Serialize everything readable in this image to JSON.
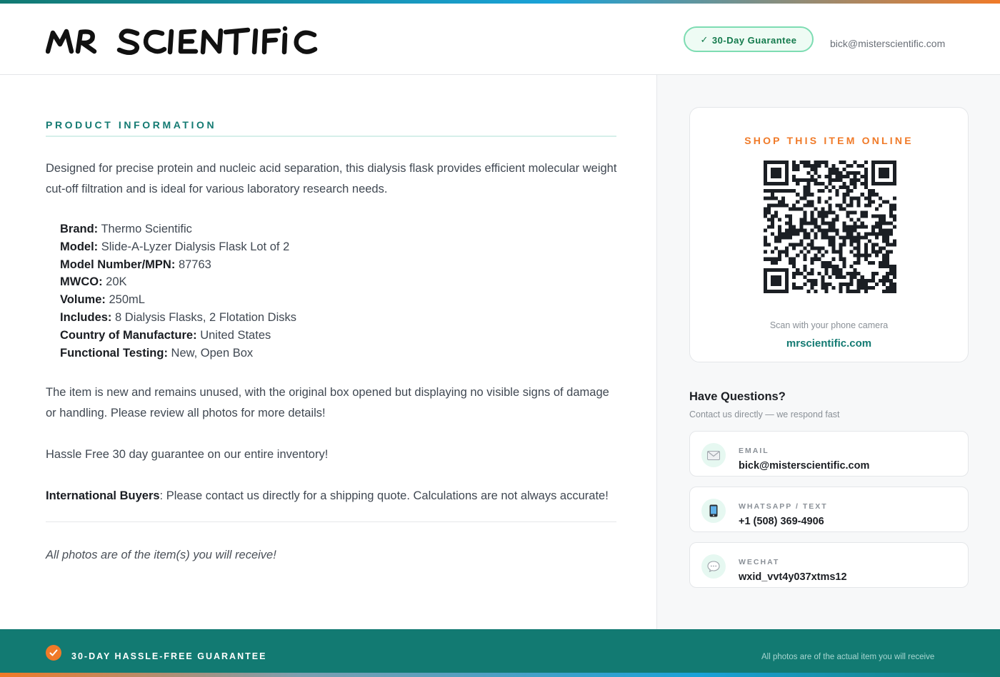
{
  "header": {
    "logo_text": "MR SCIENTIFIC",
    "guarantee_badge": "30-Day Guarantee",
    "guarantee_check": "✓",
    "email": "bick@misterscientific.com"
  },
  "product": {
    "section_title": "PRODUCT INFORMATION",
    "intro": "Designed for precise protein and nucleic acid separation, this dialysis flask provides efficient molecular weight cut-off filtration and is ideal for various laboratory research needs.",
    "specs": [
      {
        "label": "Brand:",
        "value": "Thermo Scientific"
      },
      {
        "label": "Model:",
        "value": "Slide-A-Lyzer Dialysis Flask Lot of 2"
      },
      {
        "label": "Model Number/MPN:",
        "value": "87763"
      },
      {
        "label": "MWCO:",
        "value": "20K"
      },
      {
        "label": "Volume:",
        "value": "250mL"
      },
      {
        "label": "Includes:",
        "value": "8 Dialysis Flasks, 2 Flotation Disks"
      },
      {
        "label": "Country of Manufacture:",
        "value": "United States"
      },
      {
        "label": "Functional Testing:",
        "value": "New, Open Box"
      }
    ],
    "condition": "The item is new and remains unused, with the original box opened but displaying no visible signs of damage or handling. Please review all photos for more details!",
    "hassle": "Hassle Free 30 day guarantee on our entire inventory!",
    "intl_label": "International Buyers",
    "intl_text": ": Please contact us directly for a shipping quote. Calculations are not always accurate!",
    "photos_note": "All photos are of the item(s) you will receive!"
  },
  "sidebar": {
    "qr_title": "SHOP THIS ITEM ONLINE",
    "qr_hint": "Scan with your phone camera",
    "qr_link": "mrscientific.com",
    "questions_title": "Have Questions?",
    "questions_sub": "Contact us directly — we respond fast",
    "contacts": [
      {
        "label": "EMAIL",
        "value": "bick@misterscientific.com",
        "icon": "envelope-icon"
      },
      {
        "label": "WHATSAPP / TEXT",
        "value": "+1 (508) 369-4906",
        "icon": "phone-icon"
      },
      {
        "label": "WECHAT",
        "value": "wxid_vvt4y037xtms12",
        "icon": "chat-bubble-icon"
      }
    ]
  },
  "footer": {
    "guarantee": "30-DAY HASSLE-FREE GUARANTEE",
    "note": "All photos are of the actual item you will receive"
  },
  "colors": {
    "teal": "#127a72",
    "orange": "#f07a28",
    "green_badge": "#137a4c"
  }
}
